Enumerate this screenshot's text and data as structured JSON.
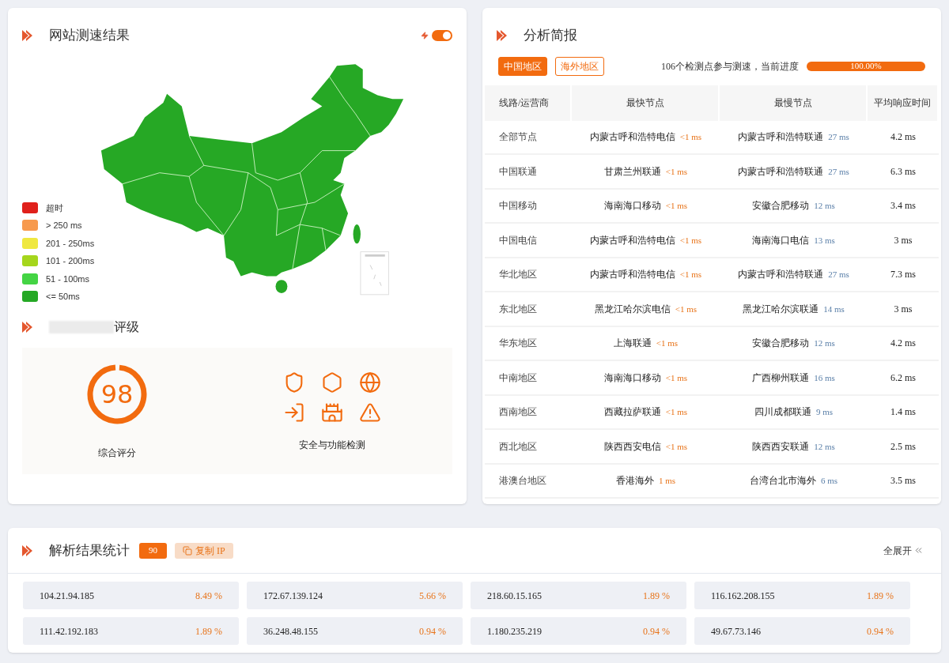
{
  "speed_panel": {
    "title": "网站测速结果",
    "toggle": {
      "on": true
    },
    "legend": [
      {
        "label": "超时",
        "color": "#e0201b"
      },
      {
        "label": "> 250 ms",
        "color": "#f79a4e"
      },
      {
        "label": "201 - 250ms",
        "color": "#efe840"
      },
      {
        "label": "101 - 200ms",
        "color": "#a5d61c"
      },
      {
        "label": "51 - 100ms",
        "color": "#44d444"
      },
      {
        "label": "<= 50ms",
        "color": "#25a825"
      }
    ]
  },
  "rating_panel": {
    "title": "评级",
    "score": {
      "value": "98",
      "label": "综合评分"
    },
    "security_label": "安全与功能检测"
  },
  "analysis_panel": {
    "title": "分析简报",
    "tabs": [
      {
        "label": "中国地区",
        "selected": true
      },
      {
        "label": "海外地区",
        "selected": false
      }
    ],
    "progress": {
      "text": "106个检测点参与测速，当前进度",
      "level": 1.0,
      "reading": "100.00%"
    },
    "table": {
      "columns": [
        "线路/运营商",
        "最快节点",
        "最慢节点",
        "平均响应时间"
      ],
      "rows": [
        {
          "line": "全部节点",
          "fastest": "内蒙古呼和浩特电信",
          "fastest_time": "<1 ms",
          "slowest": "内蒙古呼和浩特联通",
          "slowest_time": "27 ms",
          "average": "4.2 ms"
        },
        {
          "line": "中国联通",
          "fastest": "甘肃兰州联通",
          "fastest_time": "<1 ms",
          "slowest": "内蒙古呼和浩特联通",
          "slowest_time": "27 ms",
          "average": "6.3 ms"
        },
        {
          "line": "中国移动",
          "fastest": "海南海口移动",
          "fastest_time": "<1 ms",
          "slowest": "安徽合肥移动",
          "slowest_time": "12 ms",
          "average": "3.4 ms"
        },
        {
          "line": "中国电信",
          "fastest": "内蒙古呼和浩特电信",
          "fastest_time": "<1 ms",
          "slowest": "海南海口电信",
          "slowest_time": "13 ms",
          "average": "3 ms"
        },
        {
          "line": "华北地区",
          "fastest": "内蒙古呼和浩特电信",
          "fastest_time": "<1 ms",
          "slowest": "内蒙古呼和浩特联通",
          "slowest_time": "27 ms",
          "average": "7.3 ms"
        },
        {
          "line": "东北地区",
          "fastest": "黑龙江哈尔滨电信",
          "fastest_time": "<1 ms",
          "slowest": "黑龙江哈尔滨联通",
          "slowest_time": "14 ms",
          "average": "3 ms"
        },
        {
          "line": "华东地区",
          "fastest": "上海联通",
          "fastest_time": "<1 ms",
          "slowest": "安徽合肥移动",
          "slowest_time": "12 ms",
          "average": "4.2 ms"
        },
        {
          "line": "中南地区",
          "fastest": "海南海口移动",
          "fastest_time": "<1 ms",
          "slowest": "广西柳州联通",
          "slowest_time": "16 ms",
          "average": "6.2 ms"
        },
        {
          "line": "西南地区",
          "fastest": "西藏拉萨联通",
          "fastest_time": "<1 ms",
          "slowest": "四川成都联通",
          "slowest_time": "9 ms",
          "average": "1.4 ms"
        },
        {
          "line": "西北地区",
          "fastest": "陕西西安电信",
          "fastest_time": "<1 ms",
          "slowest": "陕西西安联通",
          "slowest_time": "12 ms",
          "average": "2.5 ms"
        },
        {
          "line": "港澳台地区",
          "fastest": "香港海外",
          "fastest_time": "1 ms",
          "slowest": "台湾台北市海外",
          "slowest_time": "6 ms",
          "average": "3.5 ms"
        }
      ]
    }
  },
  "resolve_panel": {
    "title": "解析结果统计",
    "count": "90",
    "copy_button": "复制 IP",
    "expand_link": "全展开",
    "ips": [
      {
        "ip": "104.21.94.185",
        "share": "8.49 %"
      },
      {
        "ip": "172.67.139.124",
        "share": "5.66 %"
      },
      {
        "ip": "218.60.15.165",
        "share": "1.89 %"
      },
      {
        "ip": "116.162.208.155",
        "share": "1.89 %"
      },
      {
        "ip": "111.42.192.183",
        "share": "1.89 %"
      },
      {
        "ip": "36.248.48.155",
        "share": "0.94 %"
      },
      {
        "ip": "1.180.235.219",
        "share": "0.94 %"
      },
      {
        "ip": "49.67.73.146",
        "share": "0.94 %"
      }
    ]
  }
}
